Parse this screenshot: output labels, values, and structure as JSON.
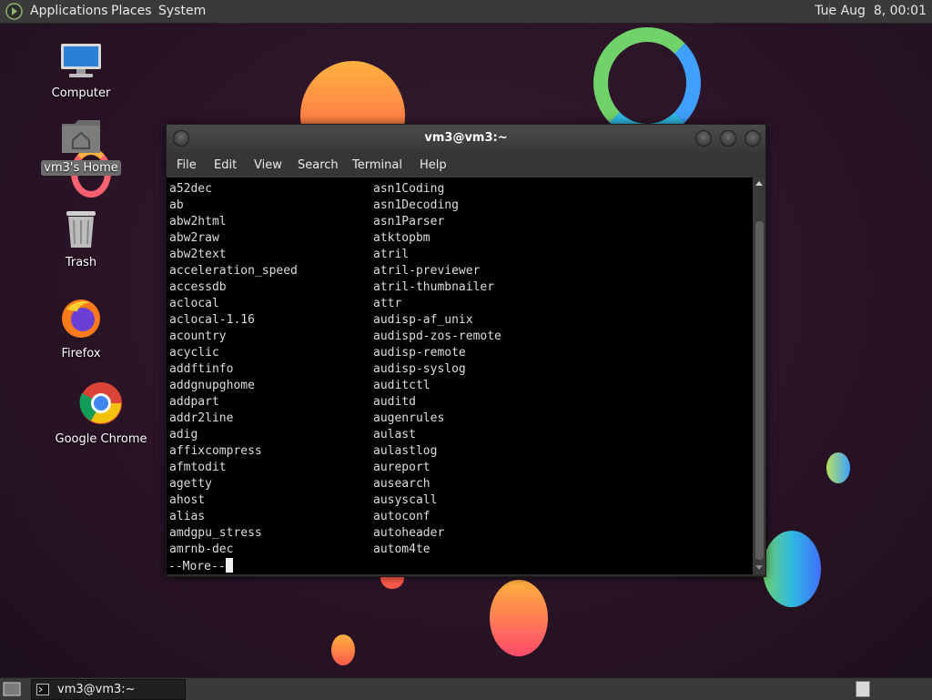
{
  "top_panel": {
    "menus": [
      "Applications",
      "Places",
      "System"
    ],
    "clock": "Tue Aug  8, 00:01"
  },
  "desktop": {
    "icons": [
      {
        "label": "Computer",
        "icon": "computer-icon"
      },
      {
        "label": "vm3's Home",
        "icon": "home-folder-icon"
      },
      {
        "label": "Trash",
        "icon": "trash-icon"
      },
      {
        "label": "Firefox",
        "icon": "firefox-icon"
      },
      {
        "label": "Google Chrome",
        "icon": "chrome-icon"
      }
    ]
  },
  "terminal": {
    "title": "vm3@vm3:~",
    "menus": [
      "File",
      "Edit",
      "View",
      "Search",
      "Terminal",
      "Help"
    ],
    "left_column": [
      "a52dec",
      "ab",
      "abw2html",
      "abw2raw",
      "abw2text",
      "acceleration_speed",
      "accessdb",
      "aclocal",
      "aclocal-1.16",
      "acountry",
      "acyclic",
      "addftinfo",
      "addgnupghome",
      "addpart",
      "addr2line",
      "adig",
      "affixcompress",
      "afmtodit",
      "agetty",
      "ahost",
      "alias",
      "amdgpu_stress",
      "amrnb-dec"
    ],
    "right_column": [
      "asn1Coding",
      "asn1Decoding",
      "asn1Parser",
      "atktopbm",
      "atril",
      "atril-previewer",
      "atril-thumbnailer",
      "attr",
      "audisp-af_unix",
      "audispd-zos-remote",
      "audisp-remote",
      "audisp-syslog",
      "auditctl",
      "auditd",
      "augenrules",
      "aulast",
      "aulastlog",
      "aureport",
      "ausearch",
      "ausyscall",
      "autoconf",
      "autoheader",
      "autom4te"
    ],
    "more_prompt": "--More--"
  },
  "bottom_panel": {
    "task_label": "vm3@vm3:~"
  },
  "colors": {
    "panel_bg": "#3a3a3a",
    "terminal_bg": "#000000",
    "terminal_fg": "#dcdcdc"
  }
}
